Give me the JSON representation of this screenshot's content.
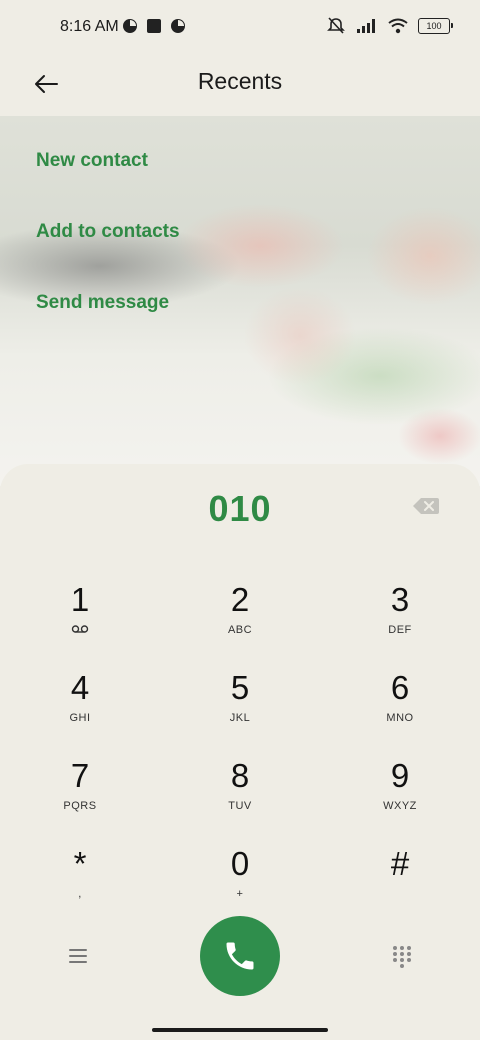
{
  "status": {
    "time": "8:16 AM",
    "battery": "100"
  },
  "header": {
    "title": "Recents"
  },
  "menu": {
    "items": [
      "New contact",
      "Add to contacts",
      "Send message"
    ]
  },
  "dialer": {
    "number": "010",
    "keys": [
      {
        "digit": "1",
        "letters": ""
      },
      {
        "digit": "2",
        "letters": "ABC"
      },
      {
        "digit": "3",
        "letters": "DEF"
      },
      {
        "digit": "4",
        "letters": "GHI"
      },
      {
        "digit": "5",
        "letters": "JKL"
      },
      {
        "digit": "6",
        "letters": "MNO"
      },
      {
        "digit": "7",
        "letters": "PQRS"
      },
      {
        "digit": "8",
        "letters": "TUV"
      },
      {
        "digit": "9",
        "letters": "WXYZ"
      },
      {
        "digit": "*",
        "letters": ","
      },
      {
        "digit": "0",
        "letters": "+"
      },
      {
        "digit": "#",
        "letters": ""
      }
    ]
  },
  "icons": {
    "back": "arrow-left-icon",
    "backspace": "backspace-icon",
    "call": "phone-icon",
    "menu": "menu-icon",
    "dialpad": "dialpad-icon",
    "voicemail": "voicemail-icon"
  },
  "colors": {
    "accent": "#2f8a45",
    "call_button": "#2f8e4c",
    "background": "#efede5"
  }
}
